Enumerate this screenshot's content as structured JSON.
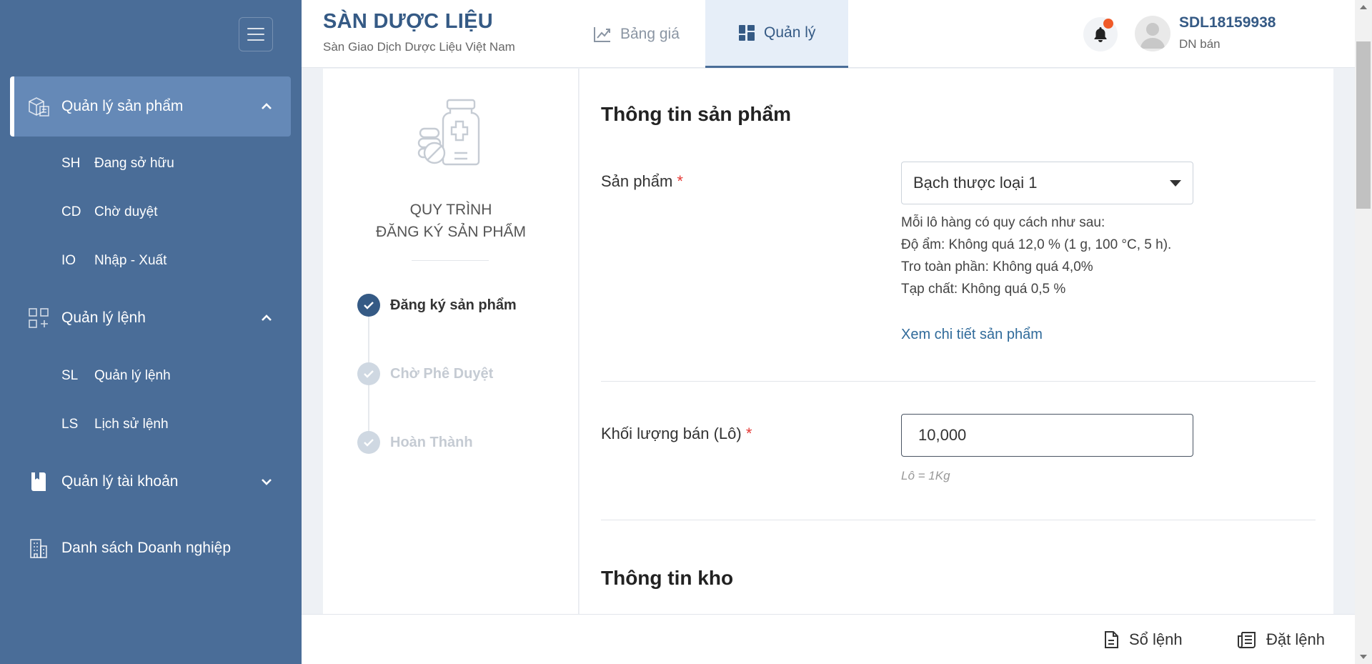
{
  "header": {
    "brand_title": "SÀN DƯỢC LIỆU",
    "brand_subtitle": "Sàn Giao Dịch Dược Liệu Việt Nam",
    "tabs": [
      {
        "label": "Bảng giá",
        "icon": "chart-line-icon",
        "active": false
      },
      {
        "label": "Quản lý",
        "icon": "dashboard-icon",
        "active": true
      }
    ],
    "user": {
      "name": "SDL18159938",
      "role": "DN bán"
    }
  },
  "sidebar": {
    "groups": [
      {
        "label": "Quản lý sản phẩm",
        "icon": "product-box-icon",
        "expanded": true,
        "items": [
          {
            "abbr": "SH",
            "label": "Đang sở hữu"
          },
          {
            "abbr": "CD",
            "label": "Chờ duyệt"
          },
          {
            "abbr": "IO",
            "label": "Nhập - Xuất"
          }
        ]
      },
      {
        "label": "Quản lý lệnh",
        "icon": "grid-add-icon",
        "expanded": true,
        "items": [
          {
            "abbr": "SL",
            "label": "Quản lý lệnh"
          },
          {
            "abbr": "LS",
            "label": "Lịch sử lệnh"
          }
        ]
      },
      {
        "label": "Quản lý tài khoản",
        "icon": "account-book-icon",
        "expanded": false,
        "items": []
      },
      {
        "label": "Danh sách Doanh nghiệp",
        "icon": "building-icon",
        "expanded": false,
        "items": []
      }
    ]
  },
  "process": {
    "title_line1": "QUY TRÌNH",
    "title_line2": "ĐĂNG KÝ SẢN PHẨM",
    "steps": [
      {
        "label": "Đăng ký sản phẩm",
        "done": true
      },
      {
        "label": "Chờ Phê Duyệt",
        "done": false
      },
      {
        "label": "Hoàn Thành",
        "done": false
      }
    ]
  },
  "form": {
    "product_section_title": "Thông tin sản phẩm",
    "product_label": "Sản phẩm",
    "required_mark": "*",
    "product_value": "Bạch thược loại 1",
    "spec_lines": [
      "Mỗi lô hàng có quy cách như sau:",
      "Độ ẩm: Không quá 12,0 % (1 g, 100 °C, 5 h).",
      "Tro toàn phần: Không quá 4,0%",
      "Tạp chất: Không quá 0,5 %"
    ],
    "detail_link": "Xem chi tiết sản phẩm",
    "quantity_label": "Khối lượng bán (Lô)",
    "quantity_value": "10,000",
    "quantity_hint": "Lô = 1Kg",
    "warehouse_section_title": "Thông tin kho"
  },
  "bottom_bar": {
    "order_book_label": "Sổ lệnh",
    "place_order_label": "Đặt lệnh"
  },
  "colors": {
    "sidebar_bg": "#4a6d98",
    "sidebar_active": "#6589b7",
    "brand": "#355a85",
    "notification": "#f05a28",
    "required": "#e53935"
  }
}
